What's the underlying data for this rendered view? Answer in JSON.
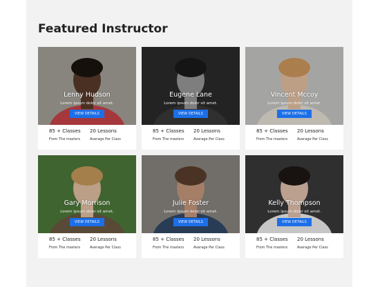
{
  "section": {
    "title": "Featured Instructor"
  },
  "instructors": [
    {
      "name": "Lenny Hudson",
      "subtitle": "Lorem ipsum dolor sit amet.",
      "button": "VIEW DETAILS",
      "classes": "85 + Classes",
      "classes_caption": "From The masters",
      "lessons": "20 Lessons",
      "lessons_caption": "Average Per Class",
      "photo": {
        "bg": "#a7a39a",
        "skin": "#5a3b2a",
        "hair": "#1c1410",
        "shirt": "#c9454b",
        "grayscale": false
      }
    },
    {
      "name": "Eugene Lane",
      "subtitle": "Lorem ipsum dolor sit amet.",
      "button": "VIEW DETAILS",
      "classes": "85 + Classes",
      "classes_caption": "From The masters",
      "lessons": "20 Lessons",
      "lessons_caption": "Average Per Class",
      "photo": {
        "bg": "#2b2b2b",
        "skin": "#9a9a9a",
        "hair": "#1a1a1a",
        "shirt": "#3a3a3a",
        "grayscale": true
      }
    },
    {
      "name": "Vincent Mccoy",
      "subtitle": "Lorem ipsum dolor sit amet.",
      "button": "VIEW DETAILS",
      "classes": "85 + Classes",
      "classes_caption": "From The masters",
      "lessons": "20 Lessons",
      "lessons_caption": "Average Per Class",
      "photo": {
        "bg": "#c9c9c6",
        "skin": "#e7c3a4",
        "hair": "#d19a5e",
        "shirt": "#e8e2d8",
        "grayscale": false
      }
    },
    {
      "name": "Gary Morrison",
      "subtitle": "Lorem ipsum dolor sit amet.",
      "button": "VIEW DETAILS",
      "classes": "85 + Classes",
      "classes_caption": "From The masters",
      "lessons": "20 Lessons",
      "lessons_caption": "Average Per Class",
      "photo": {
        "bg": "#4f7a3a",
        "skin": "#e5c2a5",
        "hair": "#c89b5d",
        "shirt": "#6d5a44",
        "grayscale": false
      }
    },
    {
      "name": "Julie Foster",
      "subtitle": "Lorem ipsum dolor sit amet.",
      "button": "VIEW DETAILS",
      "classes": "85 + Classes",
      "classes_caption": "From The masters",
      "lessons": "20 Lessons",
      "lessons_caption": "Average Per Class",
      "photo": {
        "bg": "#8a8580",
        "skin": "#c89a7e",
        "hair": "#5b3f2c",
        "shirt": "#334a6a",
        "grayscale": false
      }
    },
    {
      "name": "Kelly Thompson",
      "subtitle": "Lorem ipsum dolor sit amet.",
      "button": "VIEW DETAILS",
      "classes": "85 + Classes",
      "classes_caption": "From The masters",
      "lessons": "20 Lessons",
      "lessons_caption": "Average Per Class",
      "photo": {
        "bg": "#3a3a3a",
        "skin": "#e4c4b0",
        "hair": "#1e1614",
        "shirt": "#f2f2f2",
        "grayscale": false
      }
    }
  ]
}
